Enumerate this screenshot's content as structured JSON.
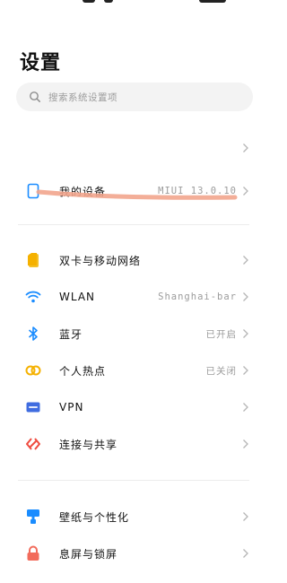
{
  "header": {
    "title": "设置"
  },
  "search": {
    "placeholder": "搜索系统设置项"
  },
  "rows": [
    {
      "label": "",
      "value": ""
    },
    {
      "label": "我的设备",
      "value": "MIUI 13.0.10"
    },
    {
      "label": "双卡与移动网络",
      "value": ""
    },
    {
      "label": "WLAN",
      "value": "Shanghai-bar"
    },
    {
      "label": "蓝牙",
      "value": "已开启"
    },
    {
      "label": "个人热点",
      "value": "已关闭"
    },
    {
      "label": "VPN",
      "value": ""
    },
    {
      "label": "连接与共享",
      "value": ""
    },
    {
      "label": "壁纸与个性化",
      "value": ""
    },
    {
      "label": "息屏与锁屏",
      "value": ""
    }
  ],
  "icons": {
    "device": "phone-outline-icon",
    "sim": "sim-card-icon",
    "wlan": "wifi-icon",
    "bluetooth": "bluetooth-icon",
    "hotspot": "hotspot-icon",
    "vpn": "vpn-icon",
    "share": "connection-share-icon",
    "wallpaper": "wallpaper-icon",
    "lock": "lock-icon"
  },
  "colors": {
    "device": "#1a8cff",
    "sim": "#f5b100",
    "wlan": "#1a8cff",
    "bluetooth": "#1a8cff",
    "hotspot": "#f5b100",
    "vpn": "#3f6ce0",
    "share": "#ef4b3f",
    "wallpaper": "#1a8cff",
    "lock": "#f26b5b",
    "annotation": "#f2a58d"
  }
}
